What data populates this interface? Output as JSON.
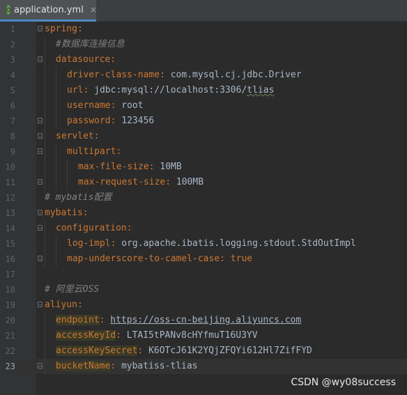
{
  "tab": {
    "filename": "application.yml",
    "close": "×"
  },
  "lines": [
    {
      "n": "1"
    },
    {
      "n": "2"
    },
    {
      "n": "3"
    },
    {
      "n": "4"
    },
    {
      "n": "5"
    },
    {
      "n": "6"
    },
    {
      "n": "7"
    },
    {
      "n": "8"
    },
    {
      "n": "9"
    },
    {
      "n": "10"
    },
    {
      "n": "11"
    },
    {
      "n": "12"
    },
    {
      "n": "13"
    },
    {
      "n": "14"
    },
    {
      "n": "15"
    },
    {
      "n": "16"
    },
    {
      "n": "17"
    },
    {
      "n": "18"
    },
    {
      "n": "19"
    },
    {
      "n": "20"
    },
    {
      "n": "21"
    },
    {
      "n": "22"
    },
    {
      "n": "23"
    }
  ],
  "code": {
    "l1": {
      "key": "spring"
    },
    "l2": {
      "comment": "#数据库连接信息"
    },
    "l3": {
      "key": "datasource"
    },
    "l4": {
      "key": "driver-class-name",
      "val": "com.mysql.cj.jdbc.Driver"
    },
    "l5": {
      "key": "url",
      "val": "jdbc:mysql://localhost:3306/",
      "val2": "tlias"
    },
    "l6": {
      "key": "username",
      "val": "root"
    },
    "l7": {
      "key": "password",
      "val": "123456"
    },
    "l8": {
      "key": "servlet"
    },
    "l9": {
      "key": "multipart"
    },
    "l10": {
      "key": "max-file-size",
      "val": "10MB"
    },
    "l11": {
      "key": "max-request-size",
      "val": "100MB"
    },
    "l12": {
      "comment": "# mybatis配置"
    },
    "l13": {
      "key": "mybatis"
    },
    "l14": {
      "key": "configuration"
    },
    "l15": {
      "key": "log-impl",
      "val": "org.apache.ibatis.logging.stdout.StdOutImpl"
    },
    "l16": {
      "key": "map-underscore-to-camel-case",
      "val": "true"
    },
    "l18": {
      "comment": "# 阿里云OSS"
    },
    "l19": {
      "key": "aliyun"
    },
    "l20": {
      "key": "endpoint",
      "val": "https://oss-cn-beijing.aliyuncs.com"
    },
    "l21": {
      "key": "accessKeyId",
      "val": "LTAI5tPANv8cHYfmuT16U3YV"
    },
    "l22": {
      "key": "accessKeySecret",
      "val": "K6OTcJ61K2YQjZFQYi612Hl7ZifFYD"
    },
    "l23": {
      "key": "bucketName",
      "val": "mybatiss-tlias"
    }
  },
  "watermark": "CSDN @wy08success",
  "colors": {
    "background": "#2b2b2b",
    "gutter": "#313335",
    "key": "#cc7832",
    "comment": "#808080",
    "value": "#a9b7c6"
  }
}
